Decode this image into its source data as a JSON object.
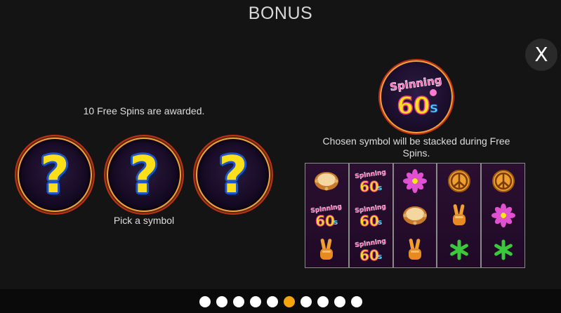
{
  "title": "BONUS",
  "close": {
    "label": "X"
  },
  "left": {
    "award_text": "10 Free Spins are awarded.",
    "pick_text": "Pick a symbol",
    "mystery_symbols": [
      {
        "label": "?"
      },
      {
        "label": "?"
      },
      {
        "label": "?"
      }
    ]
  },
  "right": {
    "logo_text": [
      "Spinning",
      "60",
      "s"
    ],
    "chosen_text": "Chosen symbol will be stacked during Free Spins.",
    "reels": [
      [
        "tambourine",
        "logo",
        "peace-hand"
      ],
      [
        "logo",
        "logo",
        "logo"
      ],
      [
        "flower",
        "tambourine",
        "peace-hand"
      ],
      [
        "peace-sign",
        "peace-hand",
        "star"
      ],
      [
        "peace-sign",
        "flower",
        "star"
      ]
    ]
  },
  "pagination": {
    "pages": 10,
    "active_index": 5
  },
  "colors": {
    "accent_orange": "#f5a30f",
    "gold": "#ffde1a",
    "pink": "#e8348c",
    "green": "#3ac93a"
  }
}
